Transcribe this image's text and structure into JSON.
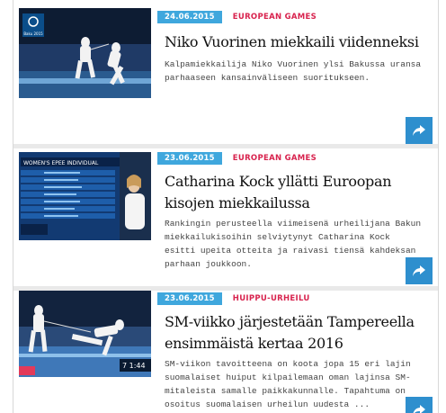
{
  "articles": [
    {
      "date": "24.06.2015",
      "category": "EUROPEAN GAMES",
      "title": "Niko Vuorinen miekkaili viidenneksi",
      "description": "Kalpamiekkailija Niko Vuorinen ylsi Bakussa uransa parhaaseen kansainväliseen suoritukseen.",
      "image": "fencing-bout-photo",
      "image_logo_text": "Baku 2015"
    },
    {
      "date": "23.06.2015",
      "category": "EUROPEAN GAMES",
      "title": "Catharina Kock yllätti Euroopan kisojen miekkailussa",
      "description": "Rankingin perusteella viimeisenä urheilijana Bakun miekkailukisoihin selviytynyt Catharina Kock esitti upeita otteita ja raivasi tiensä kahdeksan parhaan joukkoon.",
      "image": "scoreboard-fencer-photo",
      "image_board_text": "WOMEN'S EPEE INDIVIDUAL"
    },
    {
      "date": "23.06.2015",
      "category": "HUIPPU-URHEILU",
      "title": "SM-viikko järjestetään Tampereella ensimmäistä kertaa 2016",
      "description": "SM-viikon tavoitteena on koota jopa 15 eri lajin suomalaiset huiput kilpailemaan oman lajinsa SM-mitaleista samalle paikkakunnalle. Tapahtuma on osoitus suomalaisen urheilun uudesta ...",
      "image": "fencing-lunge-photo",
      "image_board_text": "7 1:44"
    }
  ],
  "icons": {
    "share": "share-arrow-icon"
  },
  "colors": {
    "date_bg": "#3fa7dd",
    "category": "#d8234e",
    "share_bg": "#2e8fce"
  }
}
